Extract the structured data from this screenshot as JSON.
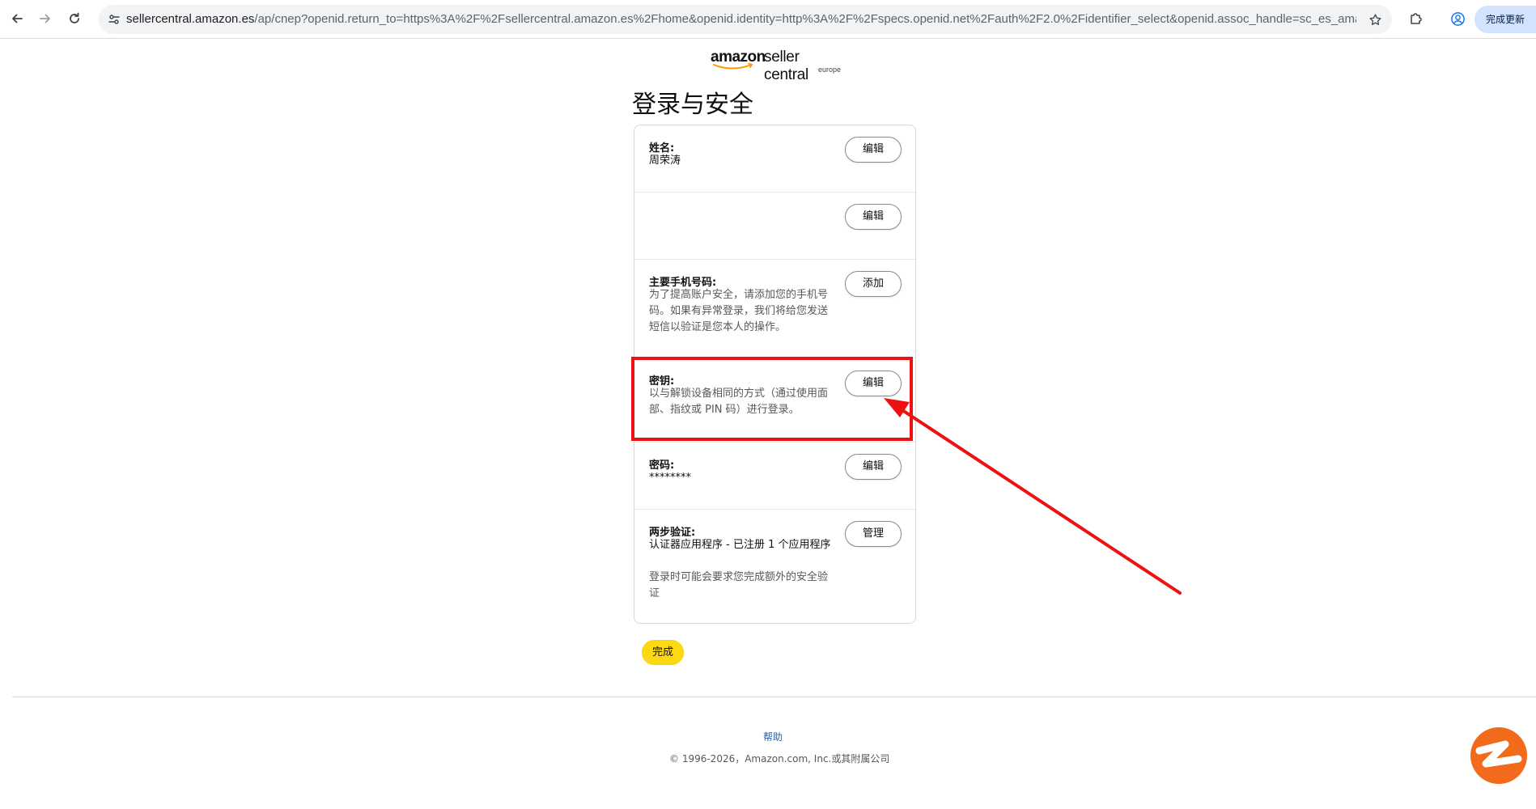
{
  "browser": {
    "url_host": "sellercentral.amazon.es",
    "url_path": "/ap/cnep?openid.return_to=https%3A%2F%2Fsellercentral.amazon.es%2Fhome&openid.identity=http%3A%2F%2Fspecs.openid.net%2Fauth%2F2.0%2Fidentifier_select&openid.assoc_handle=sc_es_ama...",
    "update_label": "完成更新"
  },
  "logo": {
    "brand": "amazon",
    "product": "seller central",
    "region": "europe"
  },
  "page_title": "登录与安全",
  "rows": [
    {
      "label": "姓名:",
      "value": "周荣涛",
      "button": "编辑"
    },
    {
      "button": "编辑"
    },
    {
      "label": "主要手机号码:",
      "description": "为了提高账户安全，请添加您的手机号码。如果有异常登录，我们将给您发送短信以验证是您本人的操作。",
      "button": "添加"
    },
    {
      "label": "密钥:",
      "description": "以与解锁设备相同的方式（通过使用面部、指纹或 PIN 码）进行登录。",
      "button": "编辑"
    },
    {
      "label": "密码:",
      "value": "********",
      "button": "编辑"
    },
    {
      "label": "两步验证:",
      "value": "认证器应用程序 - 已注册 1 个应用程序",
      "description": "登录时可能会要求您完成额外的安全验证",
      "button": "管理"
    }
  ],
  "done_button": "完成",
  "footer": {
    "help": "帮助",
    "copyright": "© 1996-2026，Amazon.com, Inc.或其附属公司"
  },
  "colors": {
    "highlight": "#ee1111",
    "primary_button": "#ffd814",
    "link": "#2162a1"
  }
}
